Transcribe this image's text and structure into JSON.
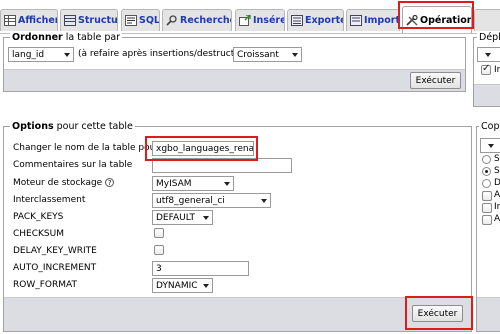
{
  "tabs": [
    {
      "label": "Afficher",
      "icon": "table-browse-icon"
    },
    {
      "label": "Structure",
      "icon": "structure-icon"
    },
    {
      "label": "SQL",
      "icon": "sql-icon"
    },
    {
      "label": "Rechercher",
      "icon": "search-icon"
    },
    {
      "label": "Insérer",
      "icon": "insert-icon"
    },
    {
      "label": "Exporter",
      "icon": "export-icon"
    },
    {
      "label": "Importer",
      "icon": "import-icon"
    },
    {
      "label": "Opérations",
      "icon": "operations-icon",
      "active": true
    }
  ],
  "order": {
    "legend_bold": "Ordonner",
    "legend_rest": " la table par",
    "column_value": "lang_id",
    "note": "(à refaire après insertions/destructions)",
    "direction_value": "Croissant",
    "submit_label": "Exécuter"
  },
  "move": {
    "legend_text": "Dépl",
    "checkbox_label": "In",
    "submit_label": "Exécuter"
  },
  "options": {
    "legend_bold": "Options",
    "legend_rest": " pour cette table",
    "rename_label": "Changer le nom de la table pour",
    "rename_value": "xgbo_languages_rena",
    "comment_label": "Commentaires sur la table",
    "comment_value": "",
    "engine_label": "Moteur de stockage",
    "engine_value": "MyISAM",
    "collation_label": "Interclassement",
    "collation_value": "utf8_general_ci",
    "pack_keys_label": "PACK_KEYS",
    "pack_keys_value": "DEFAULT",
    "checksum_label": "CHECKSUM",
    "delay_key_write_label": "DELAY_KEY_WRITE",
    "auto_increment_label": "AUTO_INCREMENT",
    "auto_increment_value": "3",
    "row_format_label": "ROW_FORMAT",
    "row_format_value": "DYNAMIC",
    "submit_label": "Exécuter"
  },
  "copy": {
    "legend_text": "Copi",
    "radio_labels": [
      "S",
      "S",
      "D"
    ],
    "check_labels": [
      "A",
      "In",
      "A"
    ]
  },
  "colors": {
    "highlight": "#e01b1b",
    "tab_text": "#1f3bb0"
  }
}
